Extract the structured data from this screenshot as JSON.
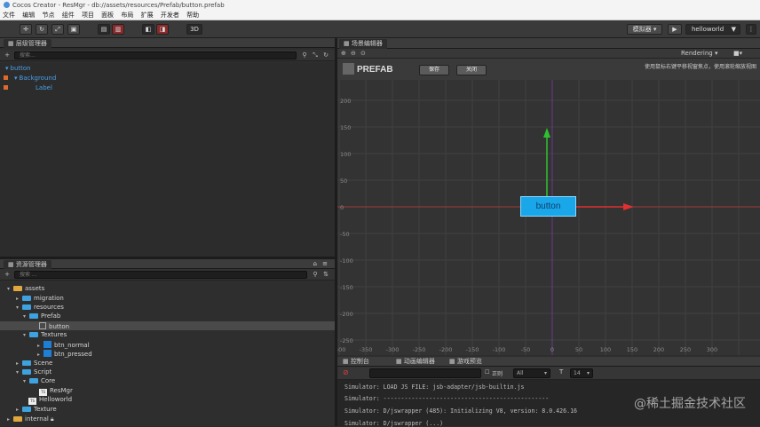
{
  "window": {
    "title": "Cocos Creator - ResMgr - db://assets/resources/Prefab/button.prefab"
  },
  "menu": [
    "文件",
    "编辑",
    "节点",
    "组件",
    "项目",
    "面板",
    "布局",
    "扩展",
    "开发者",
    "帮助"
  ],
  "toolbar": {
    "btn_3d": "3D",
    "simulator_label": "模拟器 ▾",
    "play_icon": "play-icon",
    "scene_select": "helloworld"
  },
  "hierarchy": {
    "title": "层级管理器",
    "search_placeholder": "搜索...",
    "nodes": [
      {
        "label": "button",
        "indent": 0
      },
      {
        "label": "Background",
        "indent": 1
      },
      {
        "label": "Label",
        "indent": 2
      }
    ]
  },
  "assets": {
    "title": "资源管理器",
    "search_placeholder": "搜索 ...",
    "items": [
      {
        "label": "assets",
        "kind": "db"
      },
      {
        "label": "migration",
        "kind": "folder"
      },
      {
        "label": "resources",
        "kind": "folder"
      },
      {
        "label": "Prefab",
        "kind": "folder"
      },
      {
        "label": "button",
        "kind": "prefab"
      },
      {
        "label": "Textures",
        "kind": "folder"
      },
      {
        "label": "btn_normal",
        "kind": "image"
      },
      {
        "label": "btn_pressed",
        "kind": "image"
      },
      {
        "label": "Scene",
        "kind": "folder"
      },
      {
        "label": "Script",
        "kind": "folder"
      },
      {
        "label": "Core",
        "kind": "folder"
      },
      {
        "label": "ResMgr",
        "kind": "ts"
      },
      {
        "label": "Helloworld",
        "kind": "ts"
      },
      {
        "label": "Texture",
        "kind": "folder"
      },
      {
        "label": "internal",
        "kind": "db"
      }
    ]
  },
  "scene": {
    "title": "场景编辑器",
    "rendering": "Rendering",
    "prefab_label": "PREFAB",
    "save_label": "保存",
    "close_label": "关闭",
    "hint": "使用鼠标右键平移视窗焦点，使用滚轮缩放视图",
    "node_label": "button",
    "y_ticks": [
      "250",
      "200",
      "150",
      "100",
      "50",
      "0",
      "-50",
      "-100",
      "-150",
      "-200",
      "-250"
    ],
    "x_ticks": [
      "-400",
      "-350",
      "-300",
      "-250",
      "-200",
      "-150",
      "-100",
      "-50",
      "0",
      "50",
      "100",
      "150",
      "200",
      "250",
      "300"
    ]
  },
  "console": {
    "tabs": [
      "控制台",
      "动画编辑器",
      "游戏预览"
    ],
    "filter_label": "正则",
    "level": "All",
    "font_size": "14",
    "lines": [
      "Simulator: LOAD JS FILE: jsb-adapter/jsb-builtin.js",
      "Simulator: -----------------------------------------------",
      "Simulator: D/jswrapper (485): Initializing V8, version: 8.0.426.16",
      "Simulator: D/jswrapper (...)"
    ]
  },
  "watermark": "@稀土掘金技术社区",
  "colors": {
    "accent": "#1aa7ea",
    "axis_x": "#e03030",
    "axis_y": "#2ec22e"
  }
}
